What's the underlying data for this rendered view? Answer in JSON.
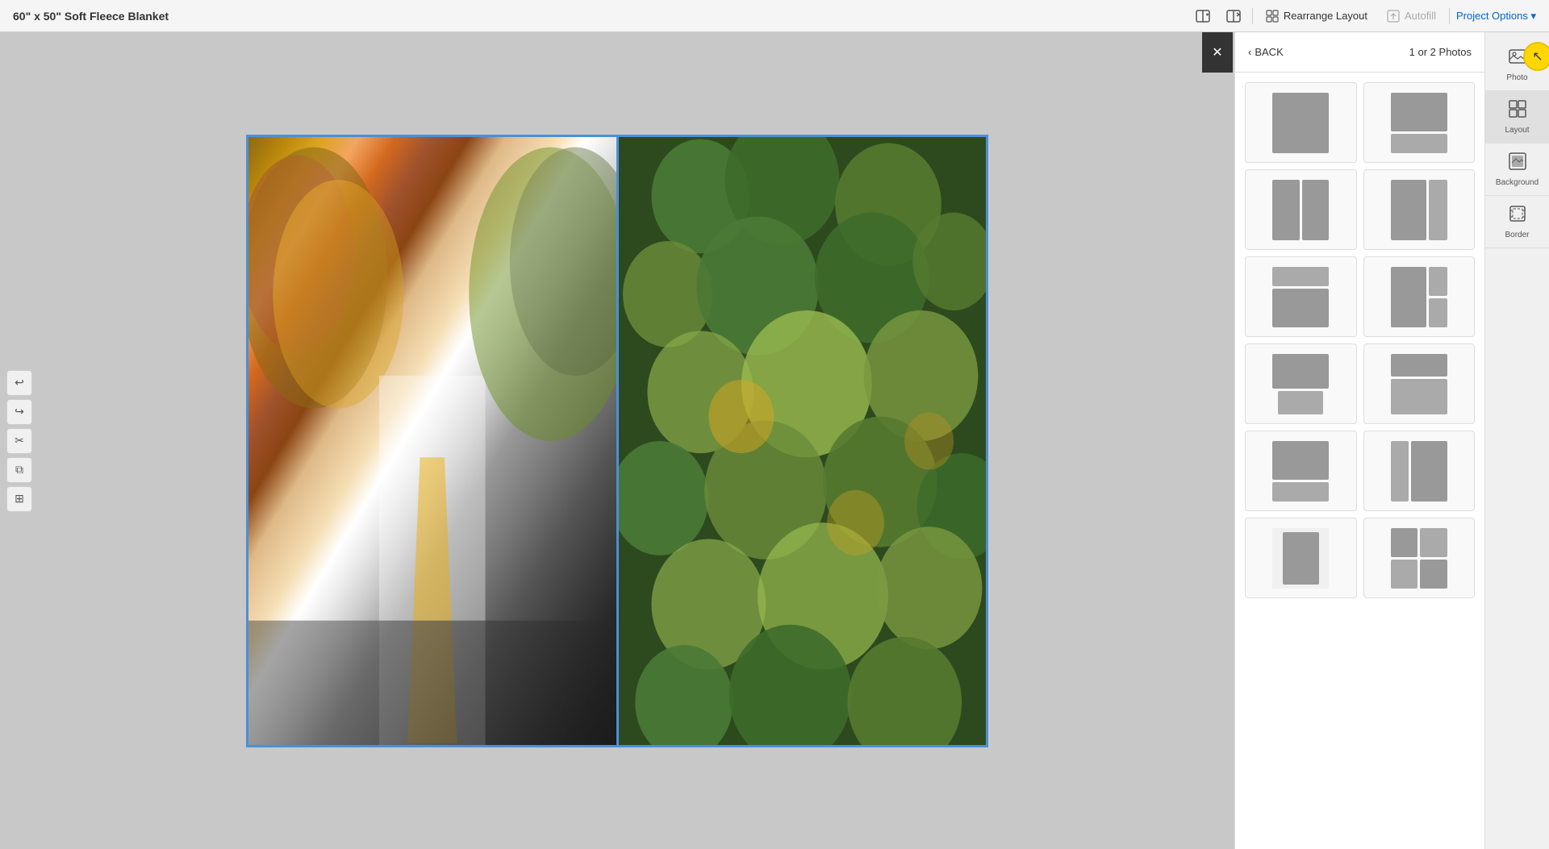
{
  "header": {
    "title": "60\" x 50\" Soft Fleece Blanket",
    "rearrange_label": "Rearrange Layout",
    "autofill_label": "Autofill",
    "project_options_label": "Project Options ▾"
  },
  "left_tools": {
    "undo": "↩",
    "redo": "↪",
    "cut": "✂",
    "copy": "⧉",
    "paste": "⊞"
  },
  "layout_panel": {
    "back_label": "BACK",
    "count_label": "1 or 2 Photos",
    "layouts": [
      {
        "id": "single",
        "type": "single"
      },
      {
        "id": "top-heavy",
        "type": "top-heavy"
      },
      {
        "id": "two-col",
        "type": "two-col"
      },
      {
        "id": "two-col-b",
        "type": "two-col"
      },
      {
        "id": "bottom-heavy",
        "type": "bottom-heavy"
      },
      {
        "id": "stacked-right",
        "type": "stacked-right"
      },
      {
        "id": "top-center",
        "type": "top-center"
      },
      {
        "id": "center-wide",
        "type": "center-wide"
      },
      {
        "id": "two-row-b",
        "type": "two-row-b"
      },
      {
        "id": "two-row-c",
        "type": "two-row-b"
      },
      {
        "id": "single-b",
        "type": "single"
      },
      {
        "id": "top-heavy-b",
        "type": "top-heavy"
      }
    ]
  },
  "right_sidebar": {
    "tools": [
      {
        "id": "photo",
        "label": "Photo",
        "icon": "🖼"
      },
      {
        "id": "layout",
        "label": "Layout",
        "icon": "⊞"
      },
      {
        "id": "background",
        "label": "Background",
        "icon": "🎨"
      },
      {
        "id": "border",
        "label": "Border",
        "icon": "⊡"
      }
    ],
    "cursor_icon": "↖"
  },
  "colors": {
    "selected_border": "#4a90d9",
    "accent": "#FFD700",
    "panel_bg": "#ffffff",
    "toolbar_bg": "#f5f5f5"
  }
}
